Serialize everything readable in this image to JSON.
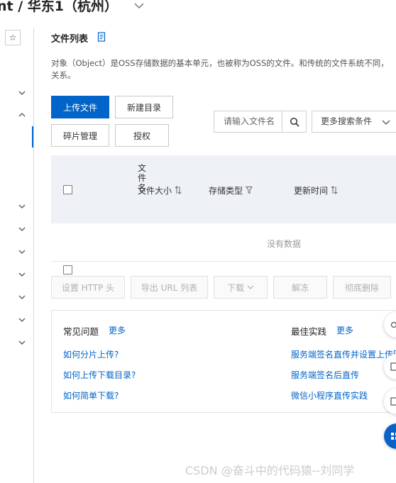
{
  "header": {
    "region_title": "nt / 华东1（杭州）"
  },
  "page": {
    "title": "文件列表",
    "description": "对象（Object）是OSS存储数据的基本单元，也被称为OSS的文件。和传统的文件系统不同，关系。"
  },
  "toolbar": {
    "upload_label": "上传文件",
    "new_dir_label": "新建目录",
    "fragment_label": "碎片管理",
    "auth_label": "授权",
    "search_placeholder": "请输入文件名",
    "more_filter_label": "更多搜索条件"
  },
  "table": {
    "columns": {
      "name": "文件名",
      "size": "文件大小",
      "storage": "存储类型",
      "updated": "更新时间"
    },
    "empty_text": "没有数据"
  },
  "bulk_actions": {
    "set_http_header": "设置 HTTP 头",
    "export_url": "导出 URL 列表",
    "download": "下载",
    "unfreeze": "解冻",
    "delete": "彻底删除"
  },
  "help": {
    "faq_title": "常见问题",
    "faq_more": "更多",
    "faq_links": [
      "如何分片上传?",
      "如何上传下载目录?",
      "如何简单下载?"
    ],
    "best_title": "最佳实践",
    "best_more": "更多",
    "best_links": [
      "服务端签名直传并设置上传回",
      "服务端签名后直传",
      "微信小程序直传实践"
    ]
  },
  "watermark": "CSDN @奋斗中的代码猿--刘同学",
  "colors": {
    "primary": "#0064c8",
    "table_header_bg": "#eef1f5",
    "link": "#0064c8"
  },
  "icons": [
    "star-icon",
    "chevron-down-icon",
    "chevron-up-icon",
    "doc-icon",
    "search-icon",
    "sort-icon",
    "filter-icon"
  ]
}
